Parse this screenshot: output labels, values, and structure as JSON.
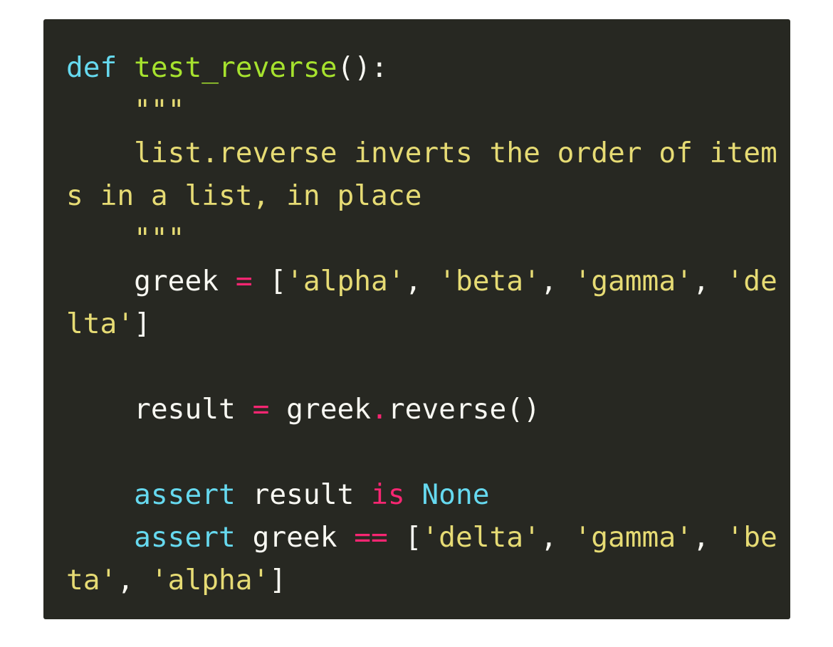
{
  "code": {
    "language": "python",
    "theme_colors": {
      "background": "#272822",
      "keyword": "#66d9ef",
      "function": "#a6e22e",
      "string": "#e6db74",
      "operator": "#f92672",
      "default": "#f8f8f2"
    },
    "lines": [
      [
        {
          "t": "def",
          "c": "kw-def"
        },
        {
          "t": " ",
          "c": "plain"
        },
        {
          "t": "test_reverse",
          "c": "fn-name"
        },
        {
          "t": "():",
          "c": "plain"
        }
      ],
      [
        {
          "t": "    \"\"\"",
          "c": "str"
        }
      ],
      [
        {
          "t": "    list.reverse inverts the order of item",
          "c": "str"
        }
      ],
      [
        {
          "t": "s in a list, in place",
          "c": "str"
        }
      ],
      [
        {
          "t": "    \"\"\"",
          "c": "str"
        }
      ],
      [
        {
          "t": "    greek ",
          "c": "plain"
        },
        {
          "t": "=",
          "c": "op"
        },
        {
          "t": " [",
          "c": "plain"
        },
        {
          "t": "'alpha'",
          "c": "str"
        },
        {
          "t": ", ",
          "c": "plain"
        },
        {
          "t": "'beta'",
          "c": "str"
        },
        {
          "t": ", ",
          "c": "plain"
        },
        {
          "t": "'gamma'",
          "c": "str"
        },
        {
          "t": ", ",
          "c": "plain"
        },
        {
          "t": "'de",
          "c": "str"
        }
      ],
      [
        {
          "t": "lta'",
          "c": "str"
        },
        {
          "t": "]",
          "c": "plain"
        }
      ],
      [],
      [
        {
          "t": "    result ",
          "c": "plain"
        },
        {
          "t": "=",
          "c": "op"
        },
        {
          "t": " greek",
          "c": "plain"
        },
        {
          "t": ".",
          "c": "op"
        },
        {
          "t": "reverse()",
          "c": "plain"
        }
      ],
      [],
      [
        {
          "t": "    ",
          "c": "plain"
        },
        {
          "t": "assert",
          "c": "kw-def"
        },
        {
          "t": " result ",
          "c": "plain"
        },
        {
          "t": "is",
          "c": "op"
        },
        {
          "t": " ",
          "c": "plain"
        },
        {
          "t": "None",
          "c": "kw-def"
        }
      ],
      [
        {
          "t": "    ",
          "c": "plain"
        },
        {
          "t": "assert",
          "c": "kw-def"
        },
        {
          "t": " greek ",
          "c": "plain"
        },
        {
          "t": "==",
          "c": "op"
        },
        {
          "t": " [",
          "c": "plain"
        },
        {
          "t": "'delta'",
          "c": "str"
        },
        {
          "t": ", ",
          "c": "plain"
        },
        {
          "t": "'gamma'",
          "c": "str"
        },
        {
          "t": ", ",
          "c": "plain"
        },
        {
          "t": "'be",
          "c": "str"
        }
      ],
      [
        {
          "t": "ta'",
          "c": "str"
        },
        {
          "t": ", ",
          "c": "plain"
        },
        {
          "t": "'alpha'",
          "c": "str"
        },
        {
          "t": "]",
          "c": "plain"
        }
      ]
    ]
  }
}
